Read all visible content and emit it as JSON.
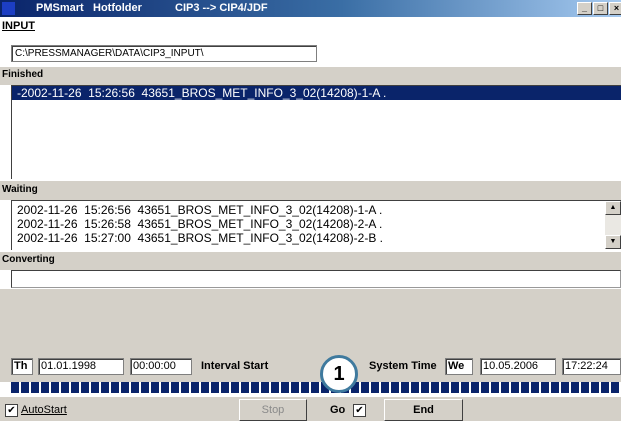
{
  "window": {
    "app_name": "PMSmart",
    "title_mid": "Hotfolder",
    "title_right": "CIP3 --> CIP4/JDF",
    "minimize": "_",
    "maximize": "□",
    "close": "×"
  },
  "input": {
    "label": "INPUT",
    "path": "C:\\PRESSMANAGER\\DATA\\CIP3_INPUT\\"
  },
  "finished": {
    "label": "Finished",
    "rows": [
      "-2002-11-26  15:26:56  43651_BROS_MET_INFO_3_02(14208)-1-A ."
    ]
  },
  "waiting": {
    "label": "Waiting",
    "rows": [
      "2002-11-26  15:26:56  43651_BROS_MET_INFO_3_02(14208)-1-A .",
      "2002-11-26  15:26:58  43651_BROS_MET_INFO_3_02(14208)-2-A .",
      "2002-11-26  15:27:00  43651_BROS_MET_INFO_3_02(14208)-2-B ."
    ],
    "scroll_up": "▲",
    "scroll_down": "▼"
  },
  "converting": {
    "label": "Converting",
    "value": ""
  },
  "interval": {
    "day": "Th",
    "date": "01.01.1998",
    "time": "00:00:00",
    "label": "Interval Start"
  },
  "system": {
    "label": "System Time",
    "day": "We",
    "date": "10.05.2006",
    "time": "17:22:24"
  },
  "progress": {
    "fraction": 1.0
  },
  "controls": {
    "autostart_label": "AutoStart",
    "autostart_checked": "✔",
    "stop_label": "Stop",
    "go_label": "Go",
    "go_checked": "✔",
    "end_label": "End"
  },
  "callout": {
    "number": "1"
  }
}
